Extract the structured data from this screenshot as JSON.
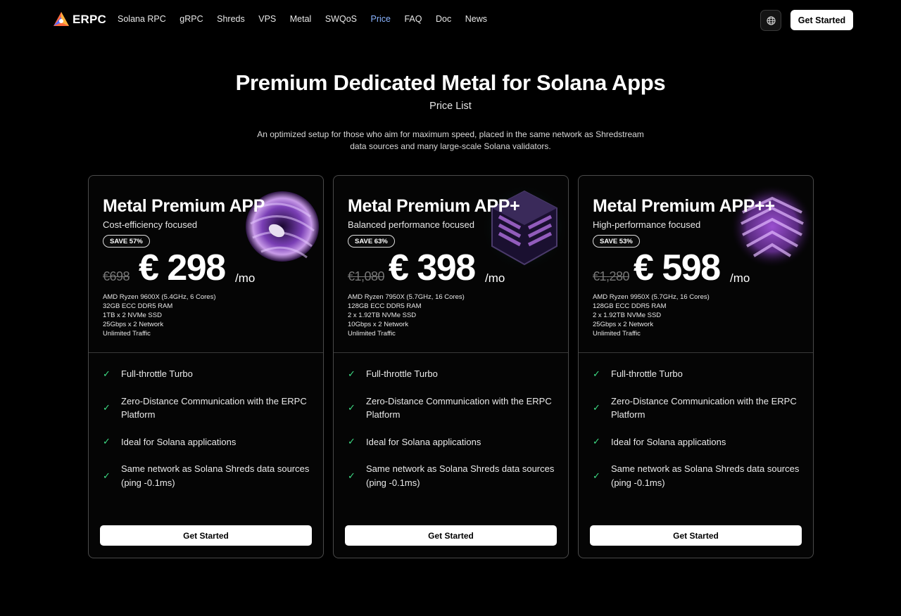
{
  "nav": {
    "logo_text": "ERPC",
    "links": [
      "Solana RPC",
      "gRPC",
      "Shreds",
      "VPS",
      "Metal",
      "SWQoS",
      "Price",
      "FAQ",
      "Doc",
      "News"
    ],
    "active_link": "Price",
    "lang_icon": "globe-icon",
    "cta_label": "Get Started"
  },
  "hero": {
    "title": "Premium Dedicated Metal for Solana Apps",
    "subtitle": "Price List",
    "description": "An optimized setup for those who aim for maximum speed, placed in the same network as Shredstream data sources and many large-scale Solana validators."
  },
  "colors": {
    "background": "#000000",
    "accent_link": "#8ab4ff",
    "check": "#3ddc84",
    "art_purple": "#7a3fb5",
    "art_teal": "#2fb8b0"
  },
  "plans": [
    {
      "name": "Metal Premium APP",
      "focus": "Cost-efficiency focused",
      "badge": "SAVE 57%",
      "old_price": "€698",
      "price": "€ 298",
      "per": "/mo",
      "specs": [
        "AMD Ryzen 9600X (5.4GHz, 6 Cores)",
        "32GB ECC DDR5 RAM",
        "1TB x 2 NVMe SSD",
        "25Gbps x 2 Network",
        "Unlimited Traffic"
      ],
      "features": [
        "Full-throttle Turbo",
        "Zero-Distance Communication with the ERPC Platform",
        "Ideal for Solana applications",
        "Same network as Solana Shreds data sources (ping -0.1ms)"
      ],
      "cta": "Get Started"
    },
    {
      "name": "Metal Premium APP+",
      "focus": "Balanced performance focused",
      "badge": "SAVE 63%",
      "old_price": "€1,080",
      "price": "€ 398",
      "per": "/mo",
      "specs": [
        "AMD Ryzen 7950X (5.7GHz, 16 Cores)",
        "128GB ECC DDR5 RAM",
        "2 x 1.92TB NVMe SSD",
        "10Gbps x 2 Network",
        "Unlimited Traffic"
      ],
      "features": [
        "Full-throttle Turbo",
        "Zero-Distance Communication with the ERPC Platform",
        "Ideal for Solana applications",
        "Same network as Solana Shreds data sources (ping -0.1ms)"
      ],
      "cta": "Get Started"
    },
    {
      "name": "Metal Premium APP++",
      "focus": "High-performance focused",
      "badge": "SAVE 53%",
      "old_price": "€1,280",
      "price": "€ 598",
      "per": "/mo",
      "specs": [
        "AMD Ryzen 9950X (5.7GHz, 16 Cores)",
        "128GB ECC DDR5 RAM",
        "2 x 1.92TB NVMe SSD",
        "25Gbps x 2 Network",
        "Unlimited Traffic"
      ],
      "features": [
        "Full-throttle Turbo",
        "Zero-Distance Communication with the ERPC Platform",
        "Ideal for Solana applications",
        "Same network as Solana Shreds data sources (ping -0.1ms)"
      ],
      "cta": "Get Started"
    }
  ]
}
